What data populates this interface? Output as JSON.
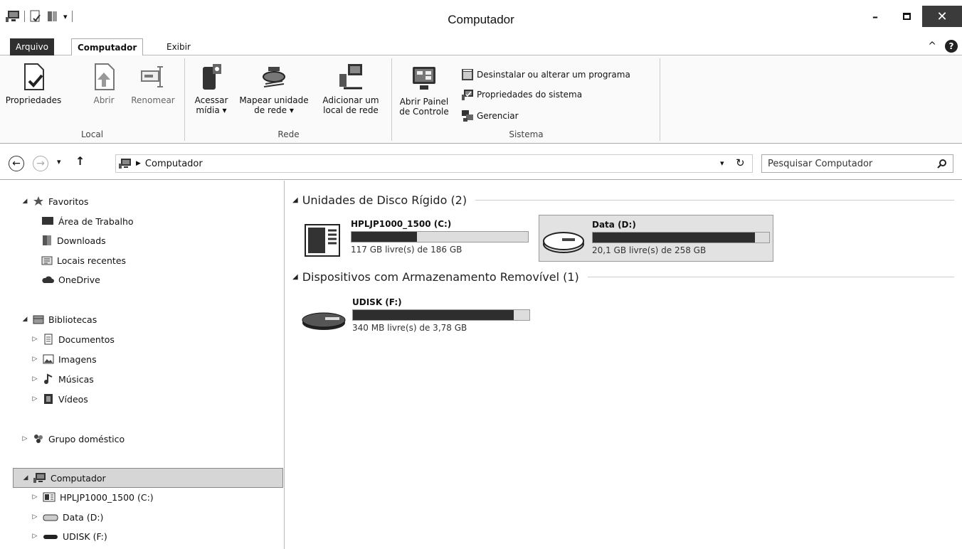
{
  "window": {
    "title": "Computador"
  },
  "ribbon_tabs": {
    "file": "Arquivo",
    "computer": "Computador",
    "view": "Exibir"
  },
  "ribbon": {
    "local": {
      "label": "Local",
      "properties": "Propriedades",
      "open": "Abrir",
      "rename": "Renomear"
    },
    "rede": {
      "label": "Rede",
      "access_media_1": "Acessar",
      "access_media_2": "mídia ▾",
      "map_drive_1": "Mapear unidade",
      "map_drive_2": "de rede ▾",
      "add_location_1": "Adicionar um",
      "add_location_2": "local de rede"
    },
    "sistema": {
      "label": "Sistema",
      "control_panel_1": "Abrir Painel",
      "control_panel_2": "de Controle",
      "uninstall": "Desinstalar ou alterar um programa",
      "system_props": "Propriedades do sistema",
      "manage": "Gerenciar"
    }
  },
  "address": {
    "path": "Computador",
    "search_placeholder": "Pesquisar Computador"
  },
  "nav": {
    "favorites": "Favoritos",
    "desktop": "Área de Trabalho",
    "downloads": "Downloads",
    "recent": "Locais recentes",
    "onedrive": "OneDrive",
    "libraries": "Bibliotecas",
    "documents": "Documentos",
    "images": "Imagens",
    "music": "Músicas",
    "videos": "Vídeos",
    "homegroup": "Grupo doméstico",
    "computer": "Computador",
    "drive_c": "HPLJP1000_1500 (C:)",
    "drive_d": "Data (D:)",
    "drive_f": "UDISK (F:)"
  },
  "content": {
    "hdd_section": "Unidades de Disco Rígido (2)",
    "removable_section": "Dispositivos com Armazenamento Removível (1)",
    "drives": [
      {
        "name": "HPLJP1000_1500 (C:)",
        "free": "117 GB livre(s) de 186 GB",
        "used_fraction": 0.37
      },
      {
        "name": "Data (D:)",
        "free": "20,1 GB livre(s) de 258 GB",
        "used_fraction": 0.92
      },
      {
        "name": "UDISK (F:)",
        "free": "340 MB livre(s) de 3,78 GB",
        "used_fraction": 0.91
      }
    ]
  }
}
